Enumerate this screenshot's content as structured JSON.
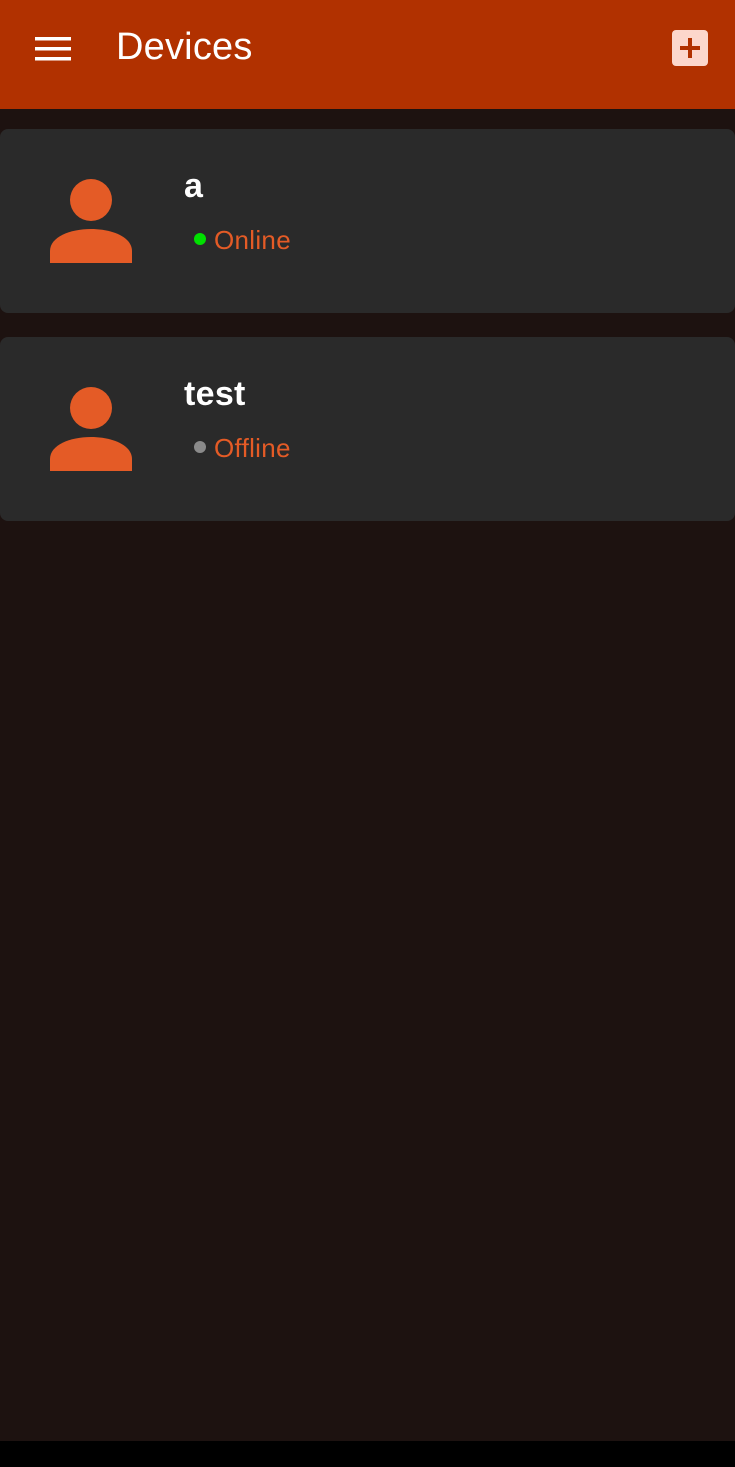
{
  "app_bar": {
    "title": "Devices",
    "menu_icon": "menu-icon",
    "add_icon": "add-box-icon"
  },
  "devices": [
    {
      "name": "a",
      "status": "Online",
      "status_color": "#00e000",
      "avatar_icon": "person-icon"
    },
    {
      "name": "test",
      "status": "Offline",
      "status_color": "#8a8a8a",
      "avatar_icon": "person-icon"
    }
  ],
  "colors": {
    "app_bar": "#b13100",
    "background": "#1d1210",
    "card": "#2a2a2a",
    "accent": "#e45b26",
    "add_icon_bg": "#fcd7cc"
  }
}
